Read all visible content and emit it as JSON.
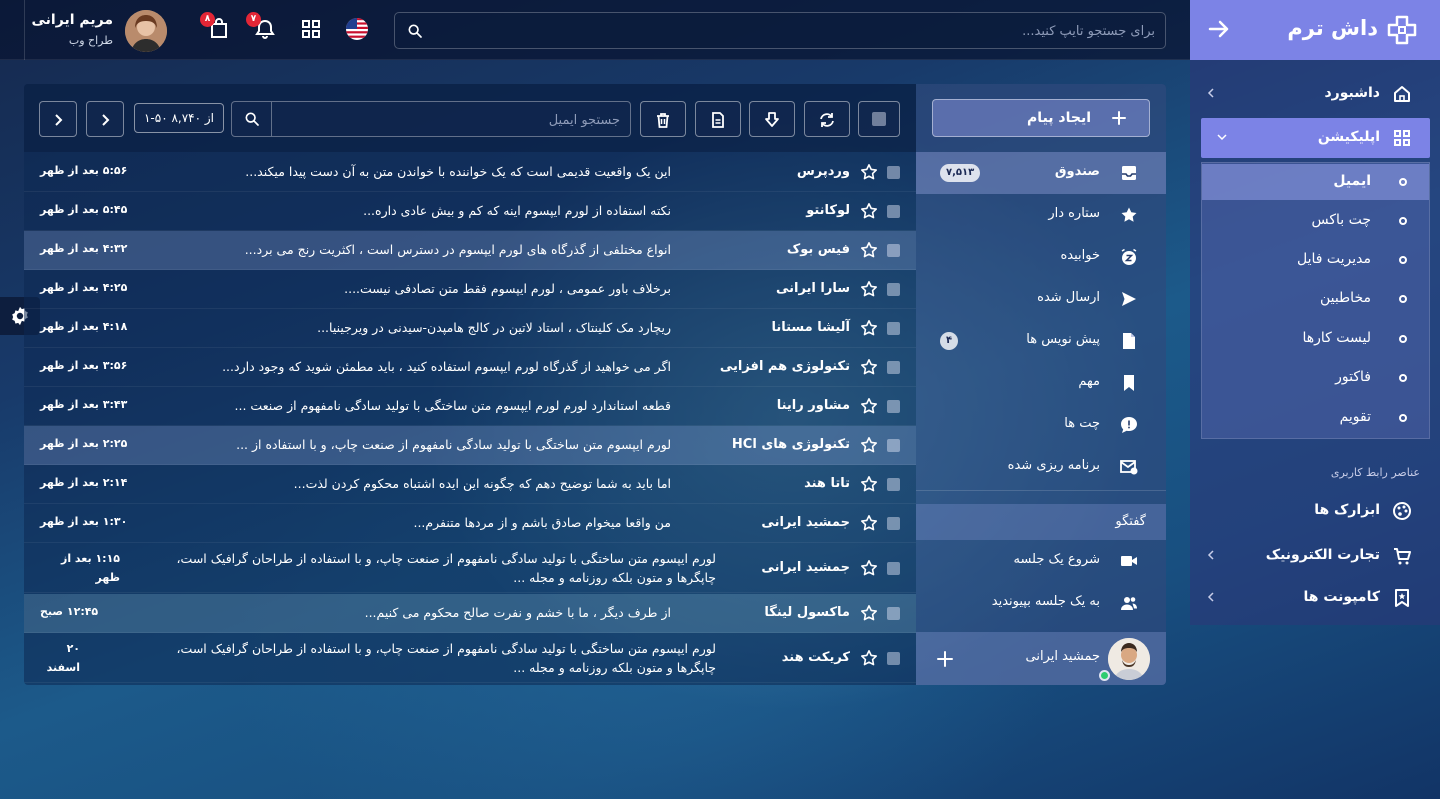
{
  "brand": {
    "name": "داش ترم"
  },
  "topbar": {
    "search_placeholder": "برای جستجو تایپ کنید...",
    "user_name": "مریم ایرانی",
    "user_role": "طراح وب",
    "notifications_count": "۷",
    "cart_count": "۸"
  },
  "sidebar": {
    "items": [
      {
        "label": "داشبورد"
      },
      {
        "label": "اپلیکیشن"
      }
    ],
    "sub_items": [
      {
        "label": "ایمیل"
      },
      {
        "label": "چت باکس"
      },
      {
        "label": "مدیریت فایل"
      },
      {
        "label": "مخاطبین"
      },
      {
        "label": "لیست کارها"
      },
      {
        "label": "فاکتور"
      },
      {
        "label": "تقویم"
      }
    ],
    "section_label": "عناصر رابط کاربری",
    "ui_items": [
      {
        "label": "ابزارک ها"
      },
      {
        "label": "تجارت الکترونیک"
      },
      {
        "label": "کامپونت ها"
      }
    ]
  },
  "mail": {
    "compose_label": "ایجاد پیام",
    "search_placeholder": "جستجو ایمیل",
    "pager": "۱-۵۰ از ۸,۷۴۰",
    "folders": [
      {
        "label": "صندوق",
        "badge": "۷,۵۱۳"
      },
      {
        "label": "ستاره دار",
        "badge": ""
      },
      {
        "label": "خوابیده",
        "badge": ""
      },
      {
        "label": "ارسال شده",
        "badge": ""
      },
      {
        "label": "پیش نویس ها",
        "badge": "۴"
      },
      {
        "label": "مهم",
        "badge": ""
      },
      {
        "label": "چت ها",
        "badge": ""
      },
      {
        "label": "برنامه ریزی شده",
        "badge": ""
      }
    ],
    "chat_header": "گفتگو",
    "chat_actions": [
      {
        "label": "شروع یک جلسه"
      },
      {
        "label": "به یک جلسه بپیوندید"
      }
    ],
    "chat_user": "جمشید ایرانی",
    "rows": [
      {
        "sender": "وردپرس",
        "subject": "این یک واقعیت قدیمی است که یک خواننده با خواندن متن به آن دست پیدا میکند...",
        "time": "۵:۵۶ بعد از ظهر"
      },
      {
        "sender": "لوکانتو",
        "subject": "نکته استفاده از لورم ایپسوم اینه که کم و بیش عادی داره...",
        "time": "۵:۴۵ بعد از ظهر"
      },
      {
        "sender": "فیس بوک",
        "subject": "انواع مختلفی از گذرگاه های لورم ایپسوم در دسترس است ، اکثریت رنج می برد...",
        "time": "۴:۳۲ بعد از ظهر"
      },
      {
        "sender": "سارا ایرانی",
        "subject": "برخلاف باور عمومی ، لورم ایپسوم فقط متن تصادفی نیست....",
        "time": "۴:۲۵ بعد از ظهر"
      },
      {
        "sender": "آلیشا مستانا",
        "subject": "ریچارد مک کلینتاک ، استاد لاتین در کالج هامپدن-سیدنی در ویرجینیا...",
        "time": "۴:۱۸ بعد از ظهر"
      },
      {
        "sender": "تکنولوژی هم افزایی",
        "subject": "اگر می خواهید از گذرگاه لورم ایپسوم استفاده کنید ، باید مطمئن شوید که وجود دارد...",
        "time": "۳:۵۶ بعد از ظهر"
      },
      {
        "sender": "مشاور راینا",
        "subject": "قطعه استاندارد لورم لورم ایپسوم متن ساختگی با تولید سادگی نامفهوم از صنعت ...",
        "time": "۳:۴۳ بعد از ظهر"
      },
      {
        "sender": "تکنولوژی های HCl",
        "subject": "لورم ایپسوم متن ساختگی با تولید سادگی نامفهوم از صنعت چاپ، و با استفاده از ...",
        "time": "۲:۲۵ بعد از ظهر"
      },
      {
        "sender": "تاتا هند",
        "subject": "اما باید به شما توضیح دهم که چگونه این ایده اشتباه محکوم کردن لذت...",
        "time": "۲:۱۴ بعد از ظهر"
      },
      {
        "sender": "جمشید ایرانی",
        "subject": "من واقعا میخوام صادق باشم و از مردها متنفرم...",
        "time": "۱:۳۰ بعد از ظهر"
      },
      {
        "sender": "جمشید ایرانی",
        "subject": "لورم ایپسوم متن ساختگی با تولید سادگی نامفهوم از صنعت چاپ، و با استفاده از طراحان گرافیک است، چاپگرها و متون بلکه روزنامه و مجله ...",
        "time": "۱:۱۵ بعد از ظهر"
      },
      {
        "sender": "ماکسول لینگا",
        "subject": "از طرف دیگر ، ما با خشم و نفرت صالح محکوم می کنیم...",
        "time": "۱۲:۴۵ صبح"
      },
      {
        "sender": "کریکت هند",
        "subject": "لورم ایپسوم متن ساختگی با تولید سادگی نامفهوم از صنعت چاپ، و با استفاده از طراحان گرافیک است، چاپگرها و متون بلکه روزنامه و مجله ...",
        "time": "۲۰ اسفند"
      }
    ]
  }
}
